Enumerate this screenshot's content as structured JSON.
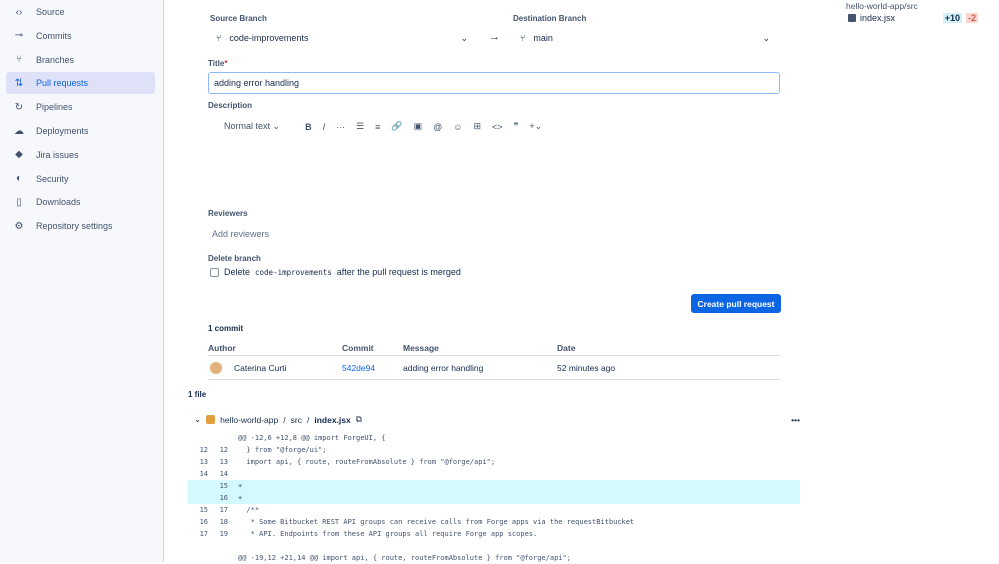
{
  "sidebar": {
    "items": [
      {
        "label": "Source",
        "icon": "code-icon",
        "glyph": "‹›"
      },
      {
        "label": "Commits",
        "icon": "commit-icon",
        "glyph": "⊸"
      },
      {
        "label": "Branches",
        "icon": "branch-icon",
        "glyph": "⑂"
      },
      {
        "label": "Pull requests",
        "icon": "pull-request-icon",
        "glyph": "⇅"
      },
      {
        "label": "Pipelines",
        "icon": "pipelines-icon",
        "glyph": "↻"
      },
      {
        "label": "Deployments",
        "icon": "cloud-icon",
        "glyph": "☁"
      },
      {
        "label": "Jira issues",
        "icon": "jira-icon",
        "glyph": "◆"
      },
      {
        "label": "Security",
        "icon": "shield-icon",
        "glyph": "◐"
      },
      {
        "label": "Downloads",
        "icon": "file-icon",
        "glyph": "▯"
      },
      {
        "label": "Repository settings",
        "icon": "gear-icon",
        "glyph": "⚙"
      }
    ]
  },
  "form": {
    "source_label": "Source Branch",
    "source_value": "code-improvements",
    "dest_label": "Destination Branch",
    "dest_value": "main",
    "title_label": "Title",
    "title_value": "adding error handling",
    "description_label": "Description",
    "toolbar": [
      "Normal text ⌄",
      "B",
      "I",
      "···",
      "☰",
      "≡",
      "🔗",
      "▣",
      "@",
      "☺",
      "⊞",
      "<>",
      "❞",
      "+⌄"
    ],
    "reviewers_label": "Reviewers",
    "reviewers_placeholder": "Add reviewers",
    "delete_label": "Delete branch",
    "delete_pre": "Delete",
    "delete_branch": "code-improvements",
    "delete_post": "after the pull request is merged",
    "create_button": "Create pull request"
  },
  "commits": {
    "count": "1 commit",
    "headers": [
      "Author",
      "Commit",
      "Message",
      "Date"
    ],
    "row": {
      "author": "Caterina Curti",
      "commit": "542de94",
      "message": "adding error handling",
      "date": "52 minutes ago"
    }
  },
  "files": {
    "count": "1 file",
    "path1": "hello-world-app",
    "path2": "src",
    "file": "index.jsx",
    "more": "•••",
    "lines": [
      {
        "o": "",
        "n": "",
        "t": "@@ -12,6 +12,8 @@ import ForgeUI, {",
        "type": "hunk"
      },
      {
        "o": "12",
        "n": "12",
        "t": "  } from \"@forge/ui\";"
      },
      {
        "o": "13",
        "n": "13",
        "t": "  import api, { route, routeFromAbsolute } from \"@forge/api\";"
      },
      {
        "o": "14",
        "n": "14",
        "t": ""
      },
      {
        "o": "",
        "n": "15",
        "t": "+",
        "type": "add"
      },
      {
        "o": "",
        "n": "16",
        "t": "+",
        "type": "add"
      },
      {
        "o": "15",
        "n": "17",
        "t": "  /**"
      },
      {
        "o": "16",
        "n": "18",
        "t": "   * Some Bitbucket REST API groups can receive calls from Forge apps via the requestBitbucket"
      },
      {
        "o": "17",
        "n": "19",
        "t": "   * API. Endpoints from these API groups all require Forge app scopes."
      },
      {
        "o": "",
        "n": "",
        "t": ""
      },
      {
        "o": "",
        "n": "",
        "t": "@@ -19,12 +21,14 @@ import api, { route, routeFromAbsolute } from \"@forge/api\";",
        "type": "hunk"
      }
    ]
  },
  "tree": {
    "folder": "hello-world-app/src",
    "file": "index.jsx",
    "added": "+10",
    "removed": "-2"
  }
}
